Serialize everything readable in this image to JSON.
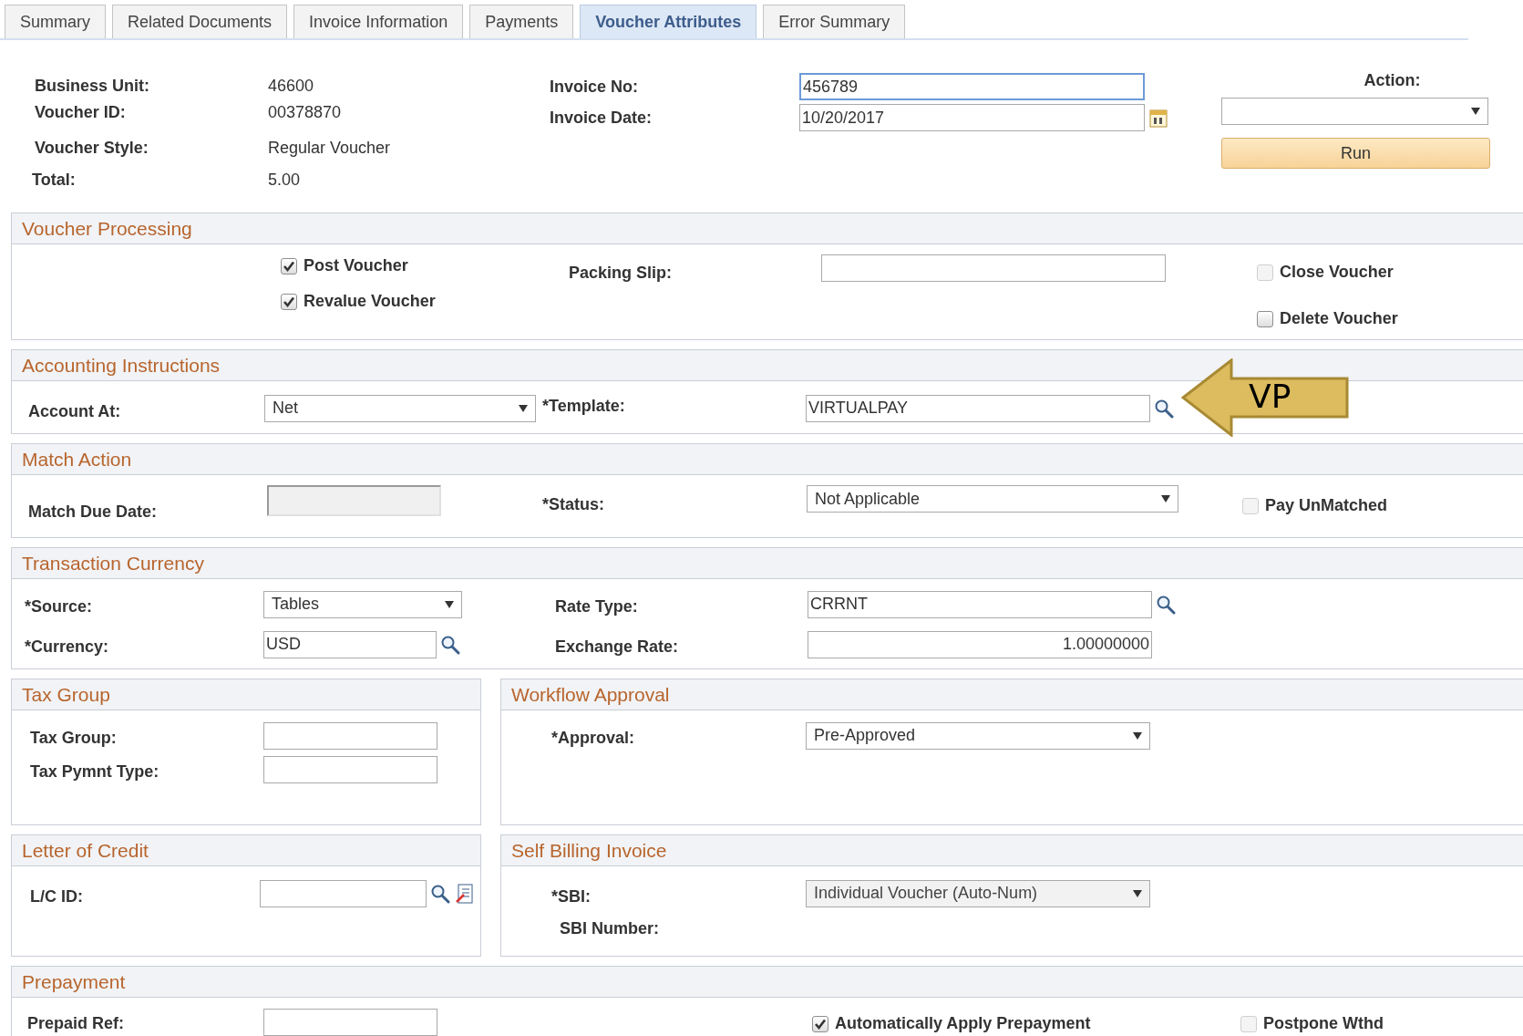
{
  "tabs": [
    {
      "label": "Summary",
      "selected": false
    },
    {
      "label": "Related Documents",
      "selected": false
    },
    {
      "label": "Invoice Information",
      "selected": false
    },
    {
      "label": "Payments",
      "selected": false
    },
    {
      "label": "Voucher Attributes",
      "selected": true
    },
    {
      "label": "Error Summary",
      "selected": false
    }
  ],
  "header": {
    "business_unit": {
      "label": "Business Unit:",
      "value": "46600"
    },
    "voucher_id": {
      "label": "Voucher ID:",
      "value": "00378870"
    },
    "voucher_style": {
      "label": "Voucher Style:",
      "value": "Regular Voucher"
    },
    "total": {
      "label": "Total:",
      "value": "5.00"
    },
    "invoice_no": {
      "label": "Invoice No:",
      "value": "456789",
      "focused": true
    },
    "invoice_date": {
      "label": "Invoice Date:",
      "value": "10/20/2017"
    },
    "action": {
      "label": "Action:",
      "button": "Run"
    }
  },
  "voucher_processing": {
    "title": "Voucher Processing",
    "post_voucher": {
      "label": "Post Voucher",
      "checked": true,
      "disabled": false
    },
    "revalue_voucher": {
      "label": "Revalue Voucher",
      "checked": true,
      "disabled": false
    },
    "packing_slip": {
      "label": "Packing Slip:"
    },
    "close_voucher": {
      "label": "Close Voucher",
      "checked": false,
      "disabled": true
    },
    "delete_voucher": {
      "label": "Delete Voucher",
      "checked": false,
      "disabled": false
    }
  },
  "accounting_instructions": {
    "title": "Accounting Instructions",
    "account_at": {
      "label": "Account At:",
      "value": "Net"
    },
    "template": {
      "label": "*Template:",
      "value": "VIRTUALPAY"
    },
    "callout": "VP"
  },
  "match_action": {
    "title": "Match Action",
    "match_due_date": {
      "label": "Match Due Date:",
      "disabled": true
    },
    "status": {
      "label": "*Status:",
      "value": "Not Applicable"
    },
    "pay_unmatched": {
      "label": "Pay UnMatched",
      "checked": false,
      "disabled": true
    }
  },
  "transaction_currency": {
    "title": "Transaction Currency",
    "source": {
      "label": "*Source:",
      "value": "Tables"
    },
    "currency": {
      "label": "*Currency:",
      "value": "USD"
    },
    "rate_type": {
      "label": "Rate Type:",
      "value": "CRRNT"
    },
    "exchange_rate": {
      "label": "Exchange Rate:",
      "value": "1.00000000"
    }
  },
  "tax_group": {
    "title": "Tax Group",
    "tax_group": {
      "label": "Tax Group:"
    },
    "tax_pymnt_type": {
      "label": "Tax Pymnt Type:"
    }
  },
  "workflow_approval": {
    "title": "Workflow Approval",
    "approval": {
      "label": "*Approval:",
      "value": "Pre-Approved"
    }
  },
  "letter_of_credit": {
    "title": "Letter of Credit",
    "lc_id": {
      "label": "L/C ID:"
    }
  },
  "self_billing_invoice": {
    "title": "Self Billing Invoice",
    "sbi": {
      "label": "*SBI:",
      "value": "Individual Voucher (Auto-Num)",
      "disabled": true
    },
    "sbi_number": {
      "label": "SBI Number:"
    }
  },
  "prepayment": {
    "title": "Prepayment",
    "prepaid_ref": {
      "label": "Prepaid Ref:"
    },
    "auto_apply": {
      "label": "Automatically Apply Prepayment",
      "checked": true,
      "disabled": false
    },
    "postpone_wthd": {
      "label": "Postpone Wthd",
      "checked": false,
      "disabled": true
    }
  }
}
